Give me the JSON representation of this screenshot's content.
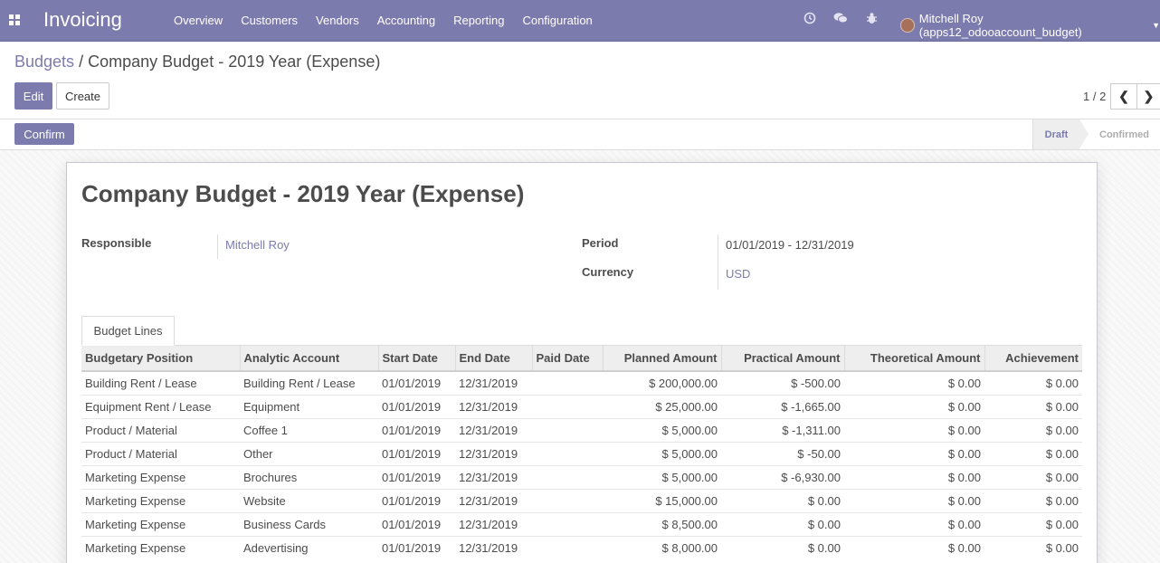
{
  "app": {
    "title": "Invoicing"
  },
  "menu": [
    "Overview",
    "Customers",
    "Vendors",
    "Accounting",
    "Reporting",
    "Configuration"
  ],
  "systray": {
    "icons": [
      "clock-icon",
      "chat-icon",
      "bug-icon"
    ]
  },
  "user": {
    "name": "Mitchell Roy (apps12_odooaccount_budget)"
  },
  "breadcrumb": {
    "parent": "Budgets",
    "separator": "/",
    "current": "Company Budget - 2019 Year (Expense)"
  },
  "buttons": {
    "edit": "Edit",
    "create": "Create",
    "confirm": "Confirm"
  },
  "pager": {
    "value": "1 / 2"
  },
  "statusbar": {
    "stages": [
      "Draft",
      "Confirmed"
    ],
    "active": "Draft"
  },
  "record": {
    "title": "Company Budget - 2019 Year (Expense)",
    "fields": {
      "responsible": {
        "label": "Responsible",
        "value": "Mitchell Roy"
      },
      "period": {
        "label": "Period",
        "value": "01/01/2019 - 12/31/2019"
      },
      "currency": {
        "label": "Currency",
        "value": "USD"
      }
    }
  },
  "notebook": {
    "tab": "Budget Lines"
  },
  "table": {
    "headers": [
      "Budgetary Position",
      "Analytic Account",
      "Start Date",
      "End Date",
      "Paid Date",
      "Planned Amount",
      "Practical Amount",
      "Theoretical Amount",
      "Achievement"
    ],
    "rows": [
      [
        "Building Rent / Lease",
        "Building Rent / Lease",
        "01/01/2019",
        "12/31/2019",
        "",
        "$ 200,000.00",
        "$ -500.00",
        "$ 0.00",
        "$ 0.00"
      ],
      [
        "Equipment Rent / Lease",
        "Equipment",
        "01/01/2019",
        "12/31/2019",
        "",
        "$ 25,000.00",
        "$ -1,665.00",
        "$ 0.00",
        "$ 0.00"
      ],
      [
        "Product / Material",
        "Coffee 1",
        "01/01/2019",
        "12/31/2019",
        "",
        "$ 5,000.00",
        "$ -1,311.00",
        "$ 0.00",
        "$ 0.00"
      ],
      [
        "Product / Material",
        "Other",
        "01/01/2019",
        "12/31/2019",
        "",
        "$ 5,000.00",
        "$ -50.00",
        "$ 0.00",
        "$ 0.00"
      ],
      [
        "Marketing Expense",
        "Brochures",
        "01/01/2019",
        "12/31/2019",
        "",
        "$ 5,000.00",
        "$ -6,930.00",
        "$ 0.00",
        "$ 0.00"
      ],
      [
        "Marketing Expense",
        "Website",
        "01/01/2019",
        "12/31/2019",
        "",
        "$ 15,000.00",
        "$ 0.00",
        "$ 0.00",
        "$ 0.00"
      ],
      [
        "Marketing Expense",
        "Business Cards",
        "01/01/2019",
        "12/31/2019",
        "",
        "$ 8,500.00",
        "$ 0.00",
        "$ 0.00",
        "$ 0.00"
      ],
      [
        "Marketing Expense",
        "Adevertising",
        "01/01/2019",
        "12/31/2019",
        "",
        "$ 8,000.00",
        "$ 0.00",
        "$ 0.00",
        "$ 0.00"
      ]
    ]
  },
  "colors": {
    "brand": "#7c7bad",
    "text": "#4c4c4c"
  }
}
